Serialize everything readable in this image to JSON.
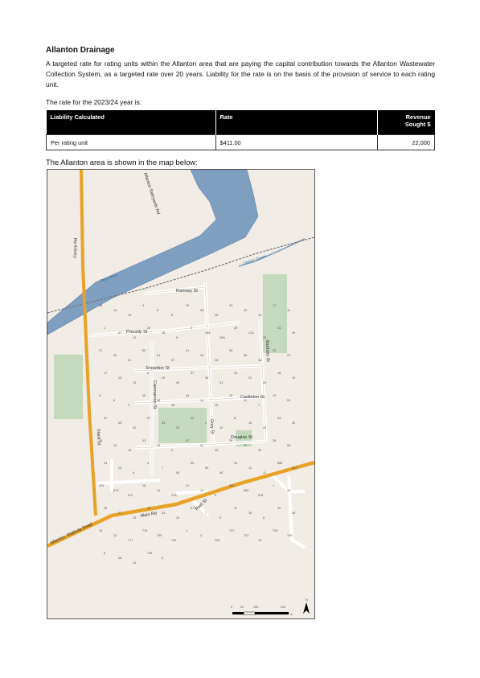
{
  "section": {
    "title": "Allanton Drainage",
    "description": "A targeted rate for rating units within the Allanton area that are paying the capital contribution towards the Allanton Wastewater Collection System, as a targeted rate over 20 years. Liability for the rate is on the basis of the provision of service to each rating unit.",
    "rate_intro": "The rate for the 2023/24 year is:"
  },
  "table": {
    "headers": [
      "Liability Calculated",
      "Rate",
      "Revenue Sought $"
    ],
    "rows": [
      [
        "Per rating unit",
        "$411.00",
        "22,000"
      ]
    ]
  },
  "map": {
    "caption": "The Allanton area is shown in the map below:",
    "roads": {
      "centre": "Centre Rd",
      "saleyards": "Allanton Saleyards Rd",
      "ramsey": "Ramsey St",
      "precelly": "Precelly St",
      "snowdon": "Snowdon St",
      "castleton": "Castleton St",
      "douglas": "Douglas St",
      "stack": "Stack St",
      "caernarvon": "Caernarvon St",
      "grey": "Grey St",
      "bardsey": "Bardsey St",
      "main": "Main Rd",
      "peel": "Peel St",
      "waihola": "Allanton- Waihola Road"
    },
    "water": {
      "taieri": "Taieri River",
      "owhiro": "Owhiro Stream"
    },
    "scale": {
      "ticks": [
        "0",
        "50",
        "100",
        "200"
      ],
      "unit": "m"
    },
    "north_label": "N",
    "parcel_numbers": [
      "28",
      "1A",
      "14",
      "4",
      "6",
      "8",
      "30",
      "28",
      "26",
      "24",
      "40",
      "31",
      "17",
      "11",
      "1",
      "47",
      "10",
      "20",
      "18",
      "9",
      "2",
      "398",
      "39A",
      "39",
      "21A",
      "33",
      "31",
      "29",
      "27",
      "25",
      "21",
      "55",
      "51",
      "67",
      "41",
      "32",
      "26",
      "34",
      "58",
      "38",
      "32",
      "21",
      "17",
      "15",
      "13",
      "5",
      "49",
      "45",
      "37",
      "35",
      "31",
      "28",
      "22",
      "20",
      "18",
      "10",
      "8",
      "6",
      "2",
      "15",
      "48",
      "46",
      "44",
      "14",
      "15",
      "13",
      "11",
      "7",
      "19",
      "51",
      "47",
      "45",
      "42",
      "37",
      "33",
      "23",
      "12",
      "4",
      "20",
      "8",
      "18",
      "49",
      "44",
      "30",
      "16",
      "14",
      "15",
      "13",
      "10",
      "9",
      "57",
      "51",
      "43",
      "39",
      "32",
      "30",
      "28",
      "26",
      "24",
      "23",
      "6",
      "3",
      "7",
      "54",
      "52",
      "50",
      "48",
      "34",
      "12",
      "11",
      "686",
      "682",
      "676",
      "674",
      "672",
      "18",
      "14",
      "21A",
      "21",
      "19",
      "9",
      "684",
      "680",
      "678",
      "1",
      "36",
      "35",
      "27",
      "23",
      "28",
      "24",
      "20",
      "671",
      "7",
      "5",
      "12",
      "10",
      "6",
      "30",
      "28",
      "25",
      "12",
      "717",
      "715",
      "709",
      "705",
      "1",
      "4",
      "725",
      "727",
      "721",
      "13",
      "735",
      "749",
      "8",
      "28",
      "24",
      "758",
      "3"
    ]
  }
}
